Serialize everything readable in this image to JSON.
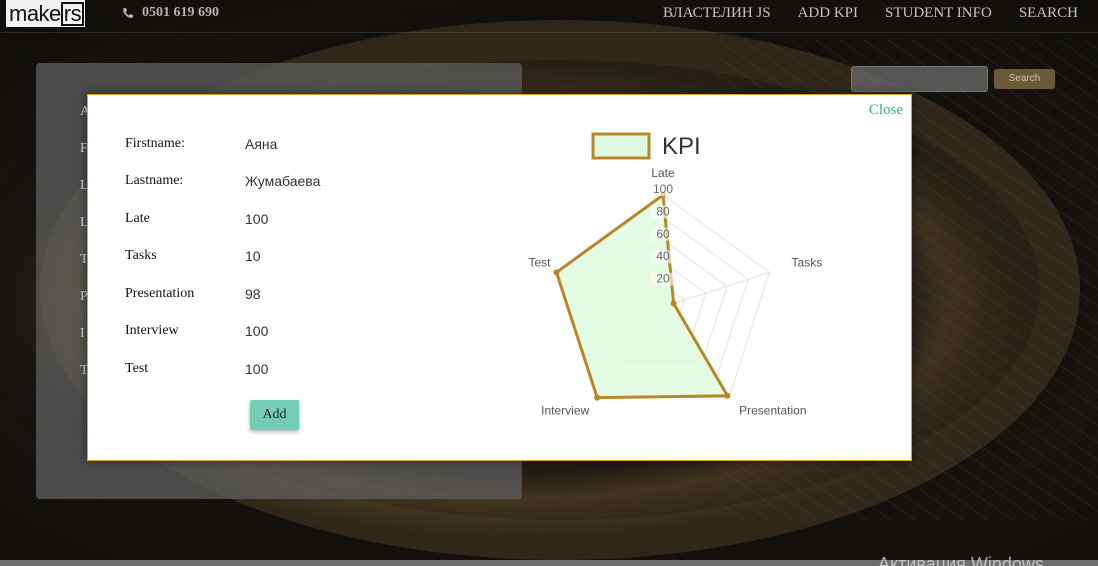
{
  "brand": {
    "logo_prefix": "make",
    "logo_boxed": "rs",
    "phone": "0501 619 690"
  },
  "nav": {
    "items": [
      "ВЛАСТЕЛИН JS",
      "ADD KPI",
      "STUDENT INFO",
      "SEARCH"
    ]
  },
  "search": {
    "button_label": "Search"
  },
  "background_panel": {
    "letters": [
      "A",
      "F",
      "L",
      "L",
      "T",
      "P",
      "I",
      "T"
    ]
  },
  "modal": {
    "close_label": "Close",
    "fields": [
      {
        "label": "Firstname:",
        "value": "Аяна"
      },
      {
        "label": "Lastname:",
        "value": "Жумабаева"
      },
      {
        "label": "Late",
        "value": "100"
      },
      {
        "label": "Tasks",
        "value": "10"
      },
      {
        "label": "Presentation",
        "value": "98"
      },
      {
        "label": "Interview",
        "value": "100"
      },
      {
        "label": "Test",
        "value": "100"
      }
    ],
    "add_label": "Add"
  },
  "chart_data": {
    "type": "radar",
    "categories": [
      "Late",
      "Tasks",
      "Presentation",
      "Interview",
      "Test"
    ],
    "series": [
      {
        "name": "KPI",
        "values": [
          100,
          10,
          98,
          100,
          100
        ],
        "color": "#b8862b",
        "fill": "#dffadf"
      }
    ],
    "ticks": [
      20,
      40,
      60,
      80,
      100
    ],
    "tick_labels": [
      "20",
      "40",
      "60",
      "80",
      "100"
    ],
    "range": [
      0,
      100
    ],
    "legend": "top"
  },
  "watermark": "Активация Windows",
  "colors": {
    "accent": "#3aa89a",
    "button": "#73cdb5",
    "modal_border": "#d9a520"
  }
}
